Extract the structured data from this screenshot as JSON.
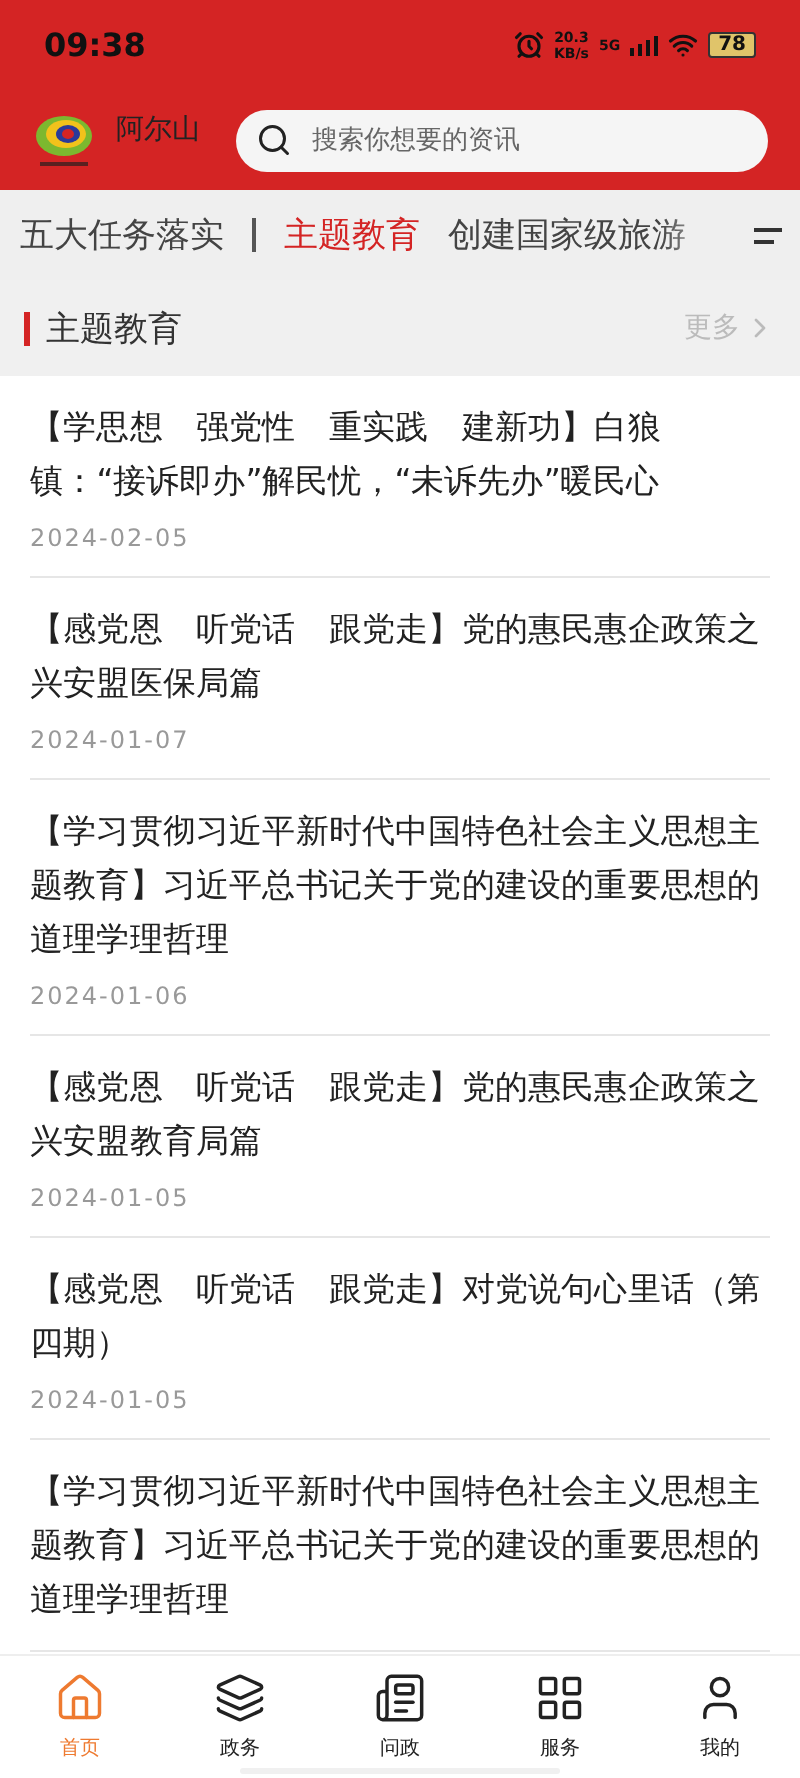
{
  "status_bar": {
    "time": "09:38",
    "speed": "20.3",
    "speed_unit": "KB/s",
    "network": "5G",
    "battery": "78"
  },
  "header": {
    "app_name": "阿尔山",
    "search": {
      "placeholder": "搜索你想要的资讯"
    }
  },
  "tabs": [
    {
      "label": "五大任务落实",
      "selected": false
    },
    {
      "label": "主题教育",
      "selected": true
    },
    {
      "label": "创建国家级旅游",
      "selected": false
    }
  ],
  "section": {
    "title": "主题教育",
    "more": "更多"
  },
  "articles": [
    {
      "title": "【学思想　强党性　重实践　建新功】白狼镇：“接诉即办”解民忧，“未诉先办”暖民心",
      "date": "2024-02-05"
    },
    {
      "title": "【感党恩　听党话　跟党走】党的惠民惠企政策之兴安盟医保局篇",
      "date": "2024-01-07"
    },
    {
      "title": "【学习贯彻习近平新时代中国特色社会主义思想主题教育】习近平总书记关于党的建设的重要思想的道理学理哲理",
      "date": "2024-01-06"
    },
    {
      "title": "【感党恩　听党话　跟党走】党的惠民惠企政策之兴安盟教育局篇",
      "date": "2024-01-05"
    },
    {
      "title": "【感党恩　听党话　跟党走】对党说句心里话（第四期）",
      "date": "2024-01-05"
    },
    {
      "title": "【学习贯彻习近平新时代中国特色社会主义思想主题教育】习近平总书记关于党的建设的重要思想的道理学理哲理"
    }
  ],
  "bottom_nav": [
    {
      "label": "首页",
      "selected": true
    },
    {
      "label": "政务",
      "selected": false
    },
    {
      "label": "问政",
      "selected": false
    },
    {
      "label": "服务",
      "selected": false
    },
    {
      "label": "我的",
      "selected": false
    }
  ]
}
